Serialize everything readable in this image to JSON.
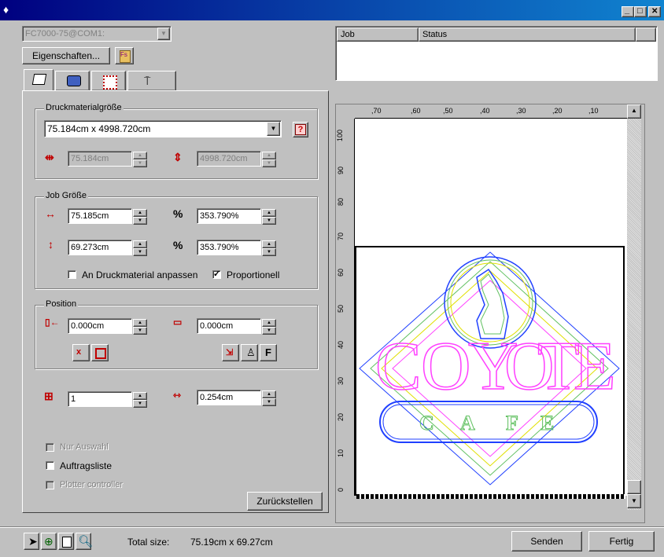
{
  "window": {
    "minimize": "_",
    "maximize": "□",
    "close": "✕"
  },
  "device": {
    "value": "FC7000-75@COM1:"
  },
  "toolbar": {
    "properties_label": "Eigenschaften..."
  },
  "queue": {
    "columns": [
      "Job",
      "Status"
    ]
  },
  "media_size": {
    "legend": "Druckmaterialgröße",
    "selected": "75.184cm x 4998.720cm",
    "width": "75.184cm",
    "height": "4998.720cm"
  },
  "job_size": {
    "legend": "Job Größe",
    "width": "75.185cm",
    "width_pct": "353.790%",
    "height": "69.273cm",
    "height_pct": "353.790%",
    "fit_label": "An Druckmaterial anpassen",
    "fit_checked": false,
    "prop_label": "Proportionell",
    "prop_checked": true
  },
  "position": {
    "legend": "Position",
    "x": "0.000cm",
    "y": "0.000cm",
    "f_label": "F"
  },
  "copies": {
    "count": "1",
    "spacing": "0.254cm"
  },
  "options": {
    "selection_only": "Nur Auswahl",
    "job_list": "Auftragsliste",
    "plotter_controller": "Plotter controller",
    "reset_label": "Zurückstellen"
  },
  "ruler": {
    "top": [
      ",70",
      ",60",
      ",50",
      ",40",
      ",30",
      ",20",
      ",10"
    ],
    "left": [
      "100",
      "90",
      "80",
      "70",
      "60",
      "50",
      "40",
      "30",
      "20",
      "10",
      "0"
    ]
  },
  "preview": {
    "logo_letters": [
      "C",
      "O",
      "Y",
      "O",
      "T",
      "E"
    ],
    "cafe_letters": [
      "C",
      "A",
      "F",
      "E"
    ]
  },
  "status_bar": {
    "total_size_label": "Total size:",
    "total_size_value": "75.19cm x 69.27cm"
  },
  "footer": {
    "send_label": "Senden",
    "done_label": "Fertig"
  }
}
